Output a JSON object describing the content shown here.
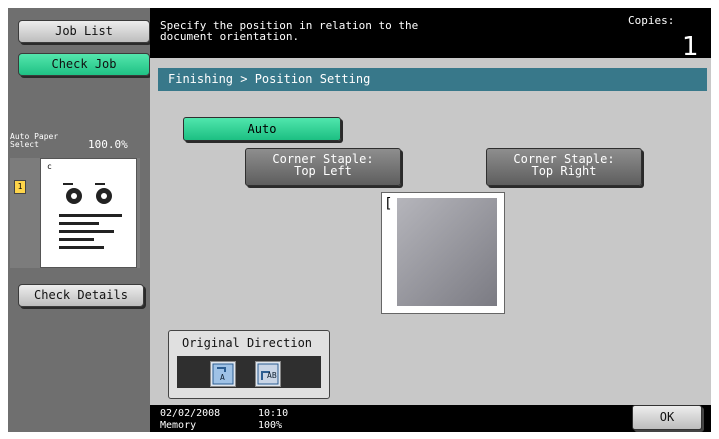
{
  "left_panel": {
    "job_list": "Job List",
    "check_job": "Check Job",
    "thumbnail": {
      "auto_paper_line1": "Auto Paper",
      "auto_paper_line2": "Select",
      "zoom": "100.0%"
    },
    "check_details": "Check Details"
  },
  "header": {
    "message": "Specify the position in relation to the\ndocument orientation.",
    "copies_label": "Copies:",
    "copies_value": "1"
  },
  "main": {
    "breadcrumb": "Finishing > Position Setting",
    "auto_label": "Auto",
    "corner_top_left": "Corner Staple:\nTop Left",
    "corner_top_right": "Corner Staple:\nTop Right",
    "original_direction": "Original Direction"
  },
  "footer": {
    "date": "02/02/2008",
    "time": "10:10",
    "memory_label": "Memory",
    "memory_value": "100%",
    "ok_label": "OK"
  },
  "colors": {
    "accent_green": "#1fc184",
    "header_teal": "#38788a"
  }
}
